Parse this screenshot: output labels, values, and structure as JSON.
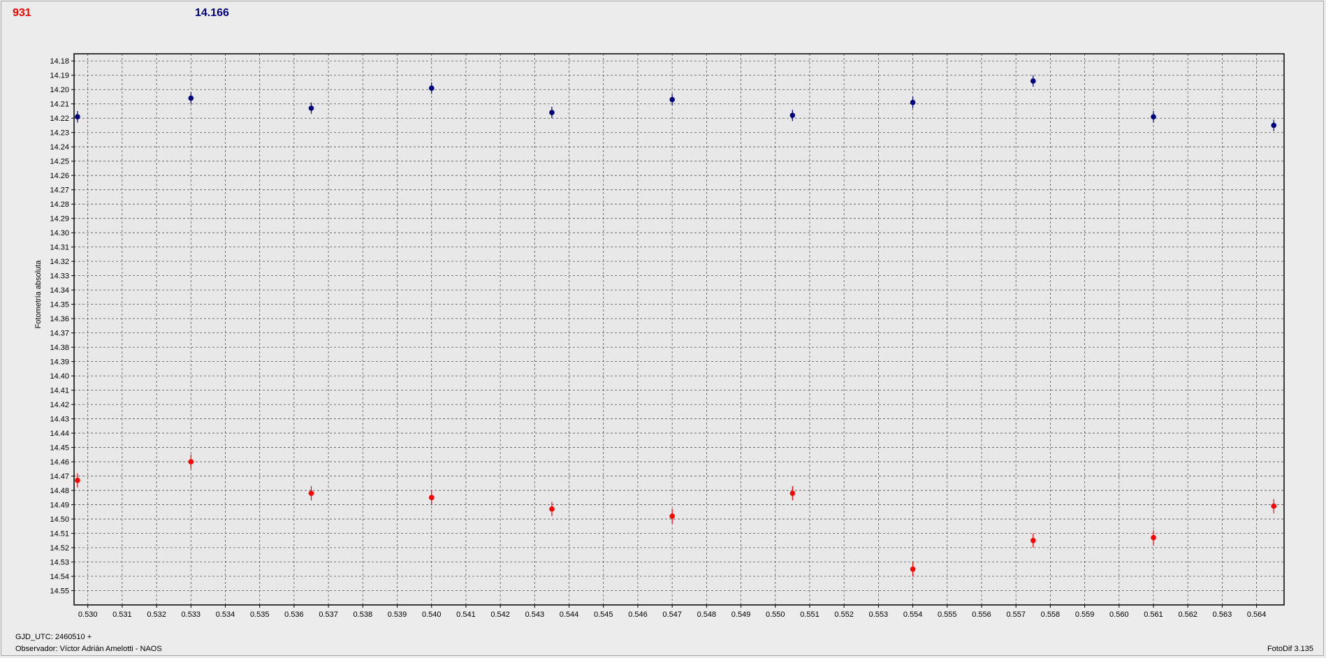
{
  "legend": {
    "series_a_label": "931",
    "series_b_label": "14.166",
    "series_a_color": "#ff0000",
    "series_b_color": "#00007f"
  },
  "footer": {
    "gjd": "GJD_UTC: 2460510 +",
    "observer": "Observador: Víctor Adrián Amelotti - NAOS",
    "software": "FotoDif 3.135"
  },
  "chart_data": {
    "type": "scatter",
    "title": "",
    "xlabel": "",
    "ylabel": "Fotometría absoluta",
    "xlim": [
      0.5296,
      0.5648
    ],
    "ylim": [
      14.175,
      14.56
    ],
    "y_inverted": true,
    "grid": true,
    "x_ticks": [
      "0.530",
      "0.531",
      "0.532",
      "0.533",
      "0.534",
      "0.535",
      "0.536",
      "0.537",
      "0.538",
      "0.539",
      "0.540",
      "0.541",
      "0.542",
      "0.543",
      "0.544",
      "0.545",
      "0.546",
      "0.547",
      "0.548",
      "0.549",
      "0.550",
      "0.551",
      "0.552",
      "0.553",
      "0.554",
      "0.555",
      "0.556",
      "0.557",
      "0.558",
      "0.559",
      "0.560",
      "0.561",
      "0.562",
      "0.563",
      "0.564"
    ],
    "y_ticks": [
      "14.18",
      "14.19",
      "14.20",
      "14.21",
      "14.22",
      "14.23",
      "14.24",
      "14.25",
      "14.26",
      "14.27",
      "14.28",
      "14.29",
      "14.30",
      "14.31",
      "14.32",
      "14.33",
      "14.34",
      "14.35",
      "14.36",
      "14.37",
      "14.38",
      "14.39",
      "14.40",
      "14.41",
      "14.42",
      "14.43",
      "14.44",
      "14.45",
      "14.46",
      "14.47",
      "14.48",
      "14.49",
      "14.50",
      "14.51",
      "14.52",
      "14.53",
      "14.54",
      "14.55"
    ],
    "series": [
      {
        "color": "#00007f",
        "x": [
          0.5297,
          0.533,
          0.5365,
          0.54,
          0.5435,
          0.547,
          0.5505,
          0.554,
          0.5575,
          0.561,
          0.5645
        ],
        "y": [
          14.219,
          14.206,
          14.213,
          14.199,
          14.216,
          14.207,
          14.218,
          14.209,
          14.194,
          14.219,
          14.225
        ],
        "err": [
          0.004,
          0.004,
          0.004,
          0.004,
          0.004,
          0.004,
          0.004,
          0.004,
          0.004,
          0.004,
          0.004
        ]
      },
      {
        "color": "#ff0000",
        "x": [
          0.5297,
          0.533,
          0.5365,
          0.54,
          0.5435,
          0.547,
          0.5505,
          0.554,
          0.5575,
          0.561,
          0.5645
        ],
        "y": [
          14.473,
          14.46,
          14.482,
          14.485,
          14.493,
          14.498,
          14.482,
          14.535,
          14.515,
          14.513,
          14.491
        ],
        "err": [
          0.005,
          0.005,
          0.005,
          0.005,
          0.005,
          0.005,
          0.005,
          0.005,
          0.005,
          0.005,
          0.005
        ]
      }
    ]
  }
}
